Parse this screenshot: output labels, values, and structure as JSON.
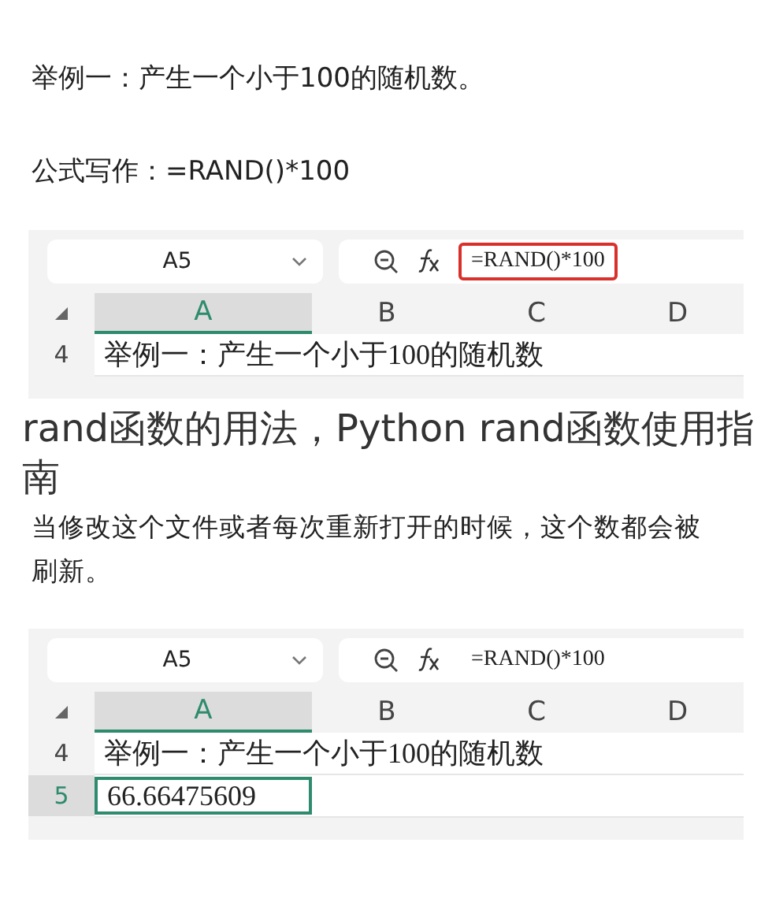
{
  "intro_lines": [
    "举例一：产生一个小于100的随机数。",
    "公式写作：=RAND()*100"
  ],
  "sheets": [
    {
      "name_box": "A5",
      "formula": "=RAND()*100",
      "formula_highlighted": true,
      "columns": [
        {
          "label": "A",
          "selected": true
        },
        {
          "label": "B",
          "selected": false
        },
        {
          "label": "C",
          "selected": false
        },
        {
          "label": "D",
          "selected": false
        }
      ],
      "rows": [
        {
          "number": "4",
          "selected": false,
          "value": "举例一：产生一个小于100的随机数"
        }
      ]
    },
    {
      "name_box": "A5",
      "formula": "=RAND()*100",
      "formula_highlighted": false,
      "columns": [
        {
          "label": "A",
          "selected": true
        },
        {
          "label": "B",
          "selected": false
        },
        {
          "label": "C",
          "selected": false
        },
        {
          "label": "D",
          "selected": false
        }
      ],
      "rows": [
        {
          "number": "4",
          "selected": false,
          "value": "举例一：产生一个小于100的随机数"
        },
        {
          "number": "5",
          "selected": true,
          "value": "66.66475609"
        }
      ]
    }
  ],
  "overlay_title": "rand函数的用法，Python rand函数使用指南",
  "note": "当修改这个文件或者每次重新打开的时候，这个数都会被刷新。"
}
